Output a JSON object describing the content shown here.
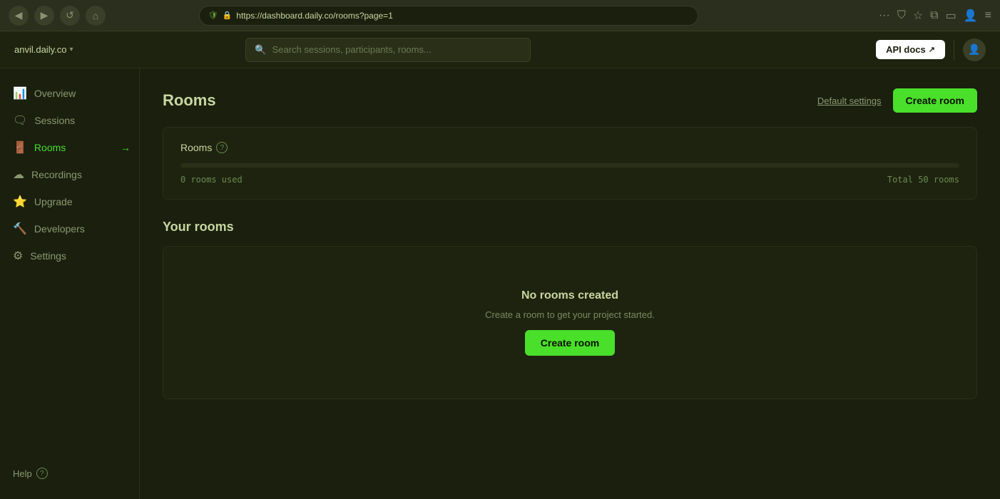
{
  "browser": {
    "url": "https://dashboard.daily.co/rooms?page=1",
    "back_btn": "◀",
    "fwd_btn": "▶",
    "reload_btn": "↺",
    "home_btn": "⌂",
    "shield": "🛡",
    "lock": "🔒",
    "more": "···",
    "pocket": "🅟",
    "star": "☆",
    "library": "⧉",
    "tablet": "▭",
    "profile": "👤",
    "menu": "≡"
  },
  "header": {
    "logo_text": "anvil.daily.co",
    "chevron": "▾",
    "search_placeholder": "Search sessions, participants, rooms...",
    "api_docs_label": "API docs",
    "ext_icon": "↗"
  },
  "sidebar": {
    "items": [
      {
        "id": "overview",
        "label": "Overview",
        "icon": "📊",
        "active": false
      },
      {
        "id": "sessions",
        "label": "Sessions",
        "icon": "🗨",
        "active": false
      },
      {
        "id": "rooms",
        "label": "Rooms",
        "icon": "🚪",
        "active": true
      },
      {
        "id": "recordings",
        "label": "Recordings",
        "icon": "☁",
        "active": false
      },
      {
        "id": "upgrade",
        "label": "Upgrade",
        "icon": "⭐",
        "active": false
      },
      {
        "id": "developers",
        "label": "Developers",
        "icon": "🔨",
        "active": false
      },
      {
        "id": "settings",
        "label": "Settings",
        "icon": "⚙",
        "active": false
      }
    ],
    "help_label": "Help",
    "help_icon": "?"
  },
  "page": {
    "title": "Rooms",
    "default_settings_label": "Default settings",
    "create_room_label": "Create room"
  },
  "rooms_card": {
    "title": "Rooms",
    "info_icon": "?",
    "rooms_used": "0 rooms used",
    "rooms_total": "Total 50 rooms",
    "progress_pct": 0
  },
  "your_rooms": {
    "section_title": "Your rooms",
    "empty_title": "No rooms created",
    "empty_subtitle": "Create a room to get your project started.",
    "create_btn_label": "Create room"
  }
}
